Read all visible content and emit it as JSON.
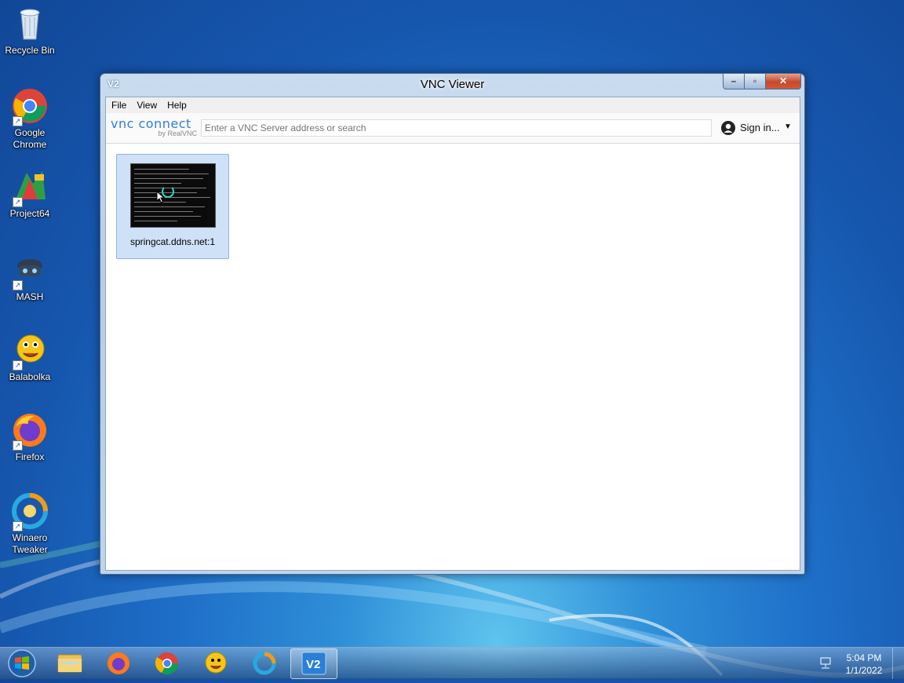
{
  "desktop": {
    "icons": [
      {
        "label": "Recycle Bin"
      },
      {
        "label": "Google Chrome"
      },
      {
        "label": "Project64"
      },
      {
        "label": "MASH"
      },
      {
        "label": "Balabolka"
      },
      {
        "label": "Firefox"
      },
      {
        "label": "Winaero Tweaker"
      }
    ]
  },
  "window": {
    "title": "VNC Viewer",
    "app_glyph": "V2",
    "menu": [
      "File",
      "View",
      "Help"
    ],
    "logo": {
      "main": "vnc connect",
      "sub": "by RealVNC"
    },
    "search": {
      "placeholder": "Enter a VNC Server address or search",
      "value": ""
    },
    "signin_label": "Sign in...",
    "connections": [
      {
        "name": "springcat.ddns.net:1"
      }
    ]
  },
  "taskbar": {
    "apps": [
      "Windows Explorer",
      "Firefox",
      "Google Chrome",
      "Balabolka",
      "Winaero Tweaker",
      "VNC Viewer"
    ],
    "active_app": "VNC Viewer",
    "clock": {
      "time": "5:04 PM",
      "date": "1/1/2022"
    }
  },
  "colors": {
    "accent": "#2e7de0",
    "selection": "#cfe1f7",
    "close": "#c4492c"
  }
}
